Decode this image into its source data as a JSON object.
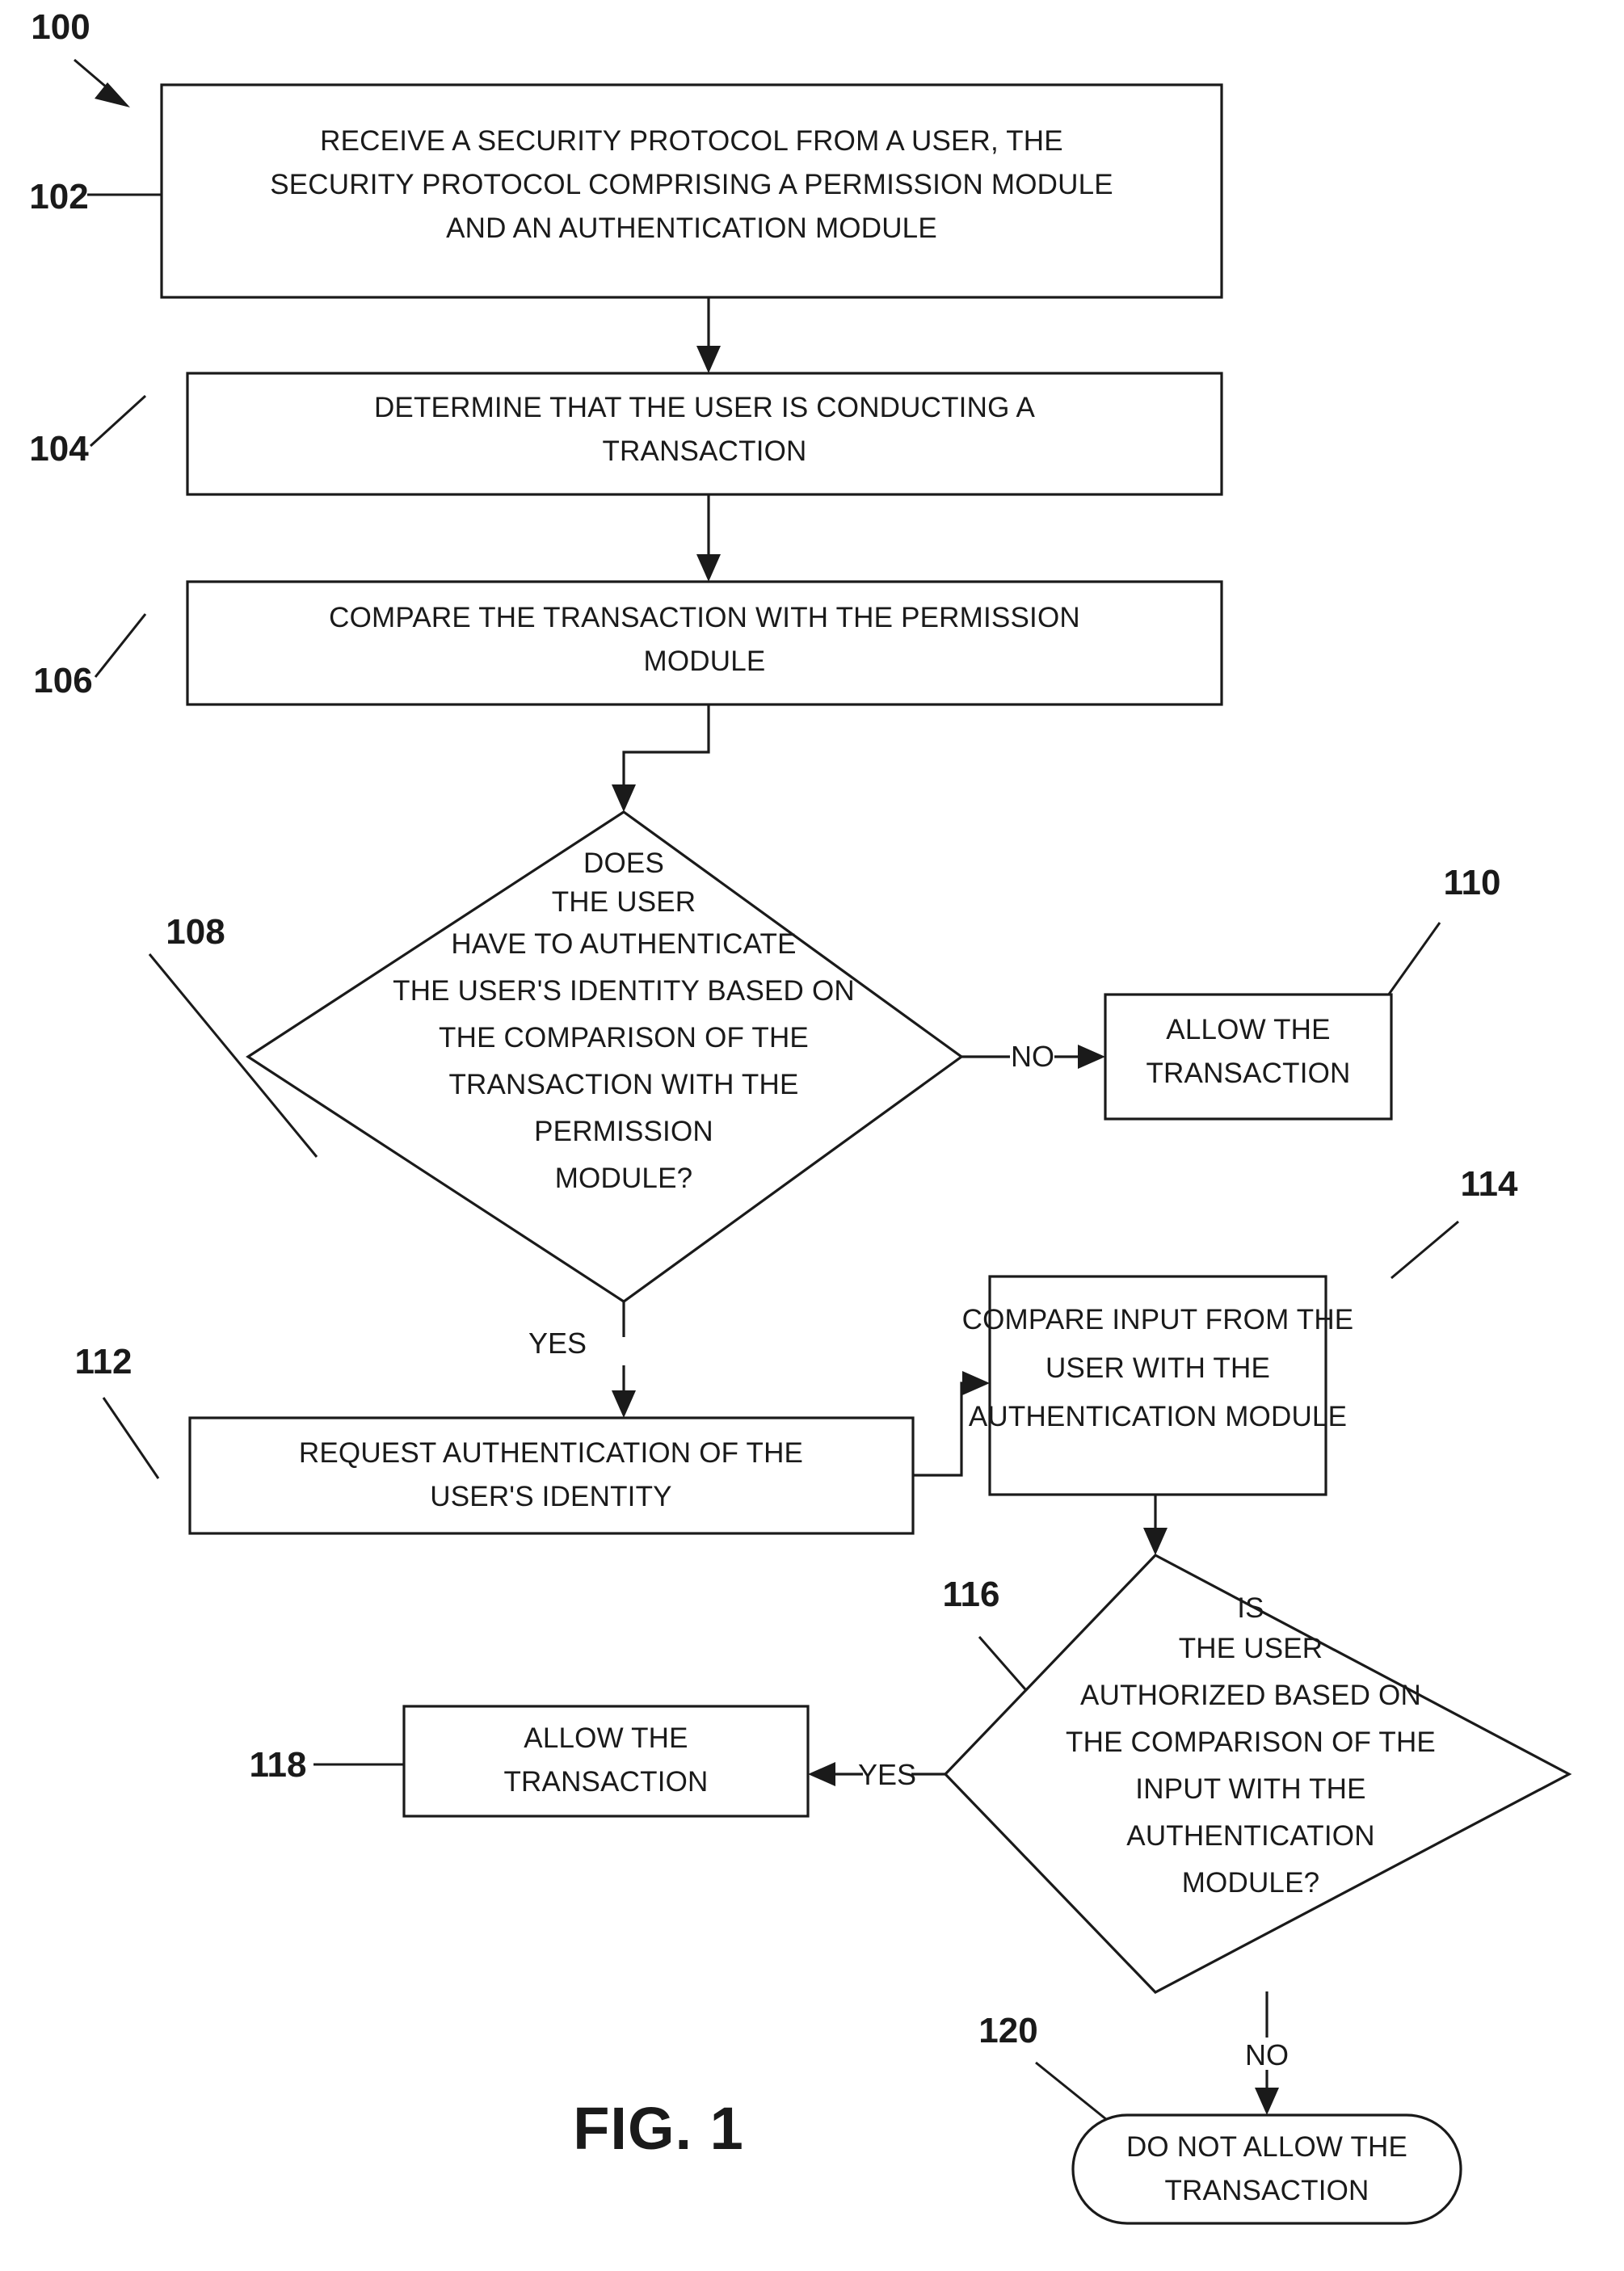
{
  "figure": {
    "caption": "FIG. 1",
    "diagram_label": "100"
  },
  "nodes": [
    {
      "id": "102",
      "ref": "102",
      "shape": "process",
      "lines": [
        "RECEIVE A SECURITY PROTOCOL FROM A USER, THE",
        "SECURITY PROTOCOL COMPRISING A PERMISSION MODULE",
        "AND AN AUTHENTICATION MODULE"
      ]
    },
    {
      "id": "104",
      "ref": "104",
      "shape": "process",
      "lines": [
        "DETERMINE THAT THE USER IS CONDUCTING A",
        "TRANSACTION"
      ]
    },
    {
      "id": "106",
      "ref": "106",
      "shape": "process",
      "lines": [
        "COMPARE THE TRANSACTION WITH THE PERMISSION",
        "MODULE"
      ]
    },
    {
      "id": "108",
      "ref": "108",
      "shape": "decision",
      "lines": [
        "DOES",
        "THE USER",
        "HAVE TO AUTHENTICATE",
        "THE USER'S IDENTITY BASED ON",
        "THE COMPARISON OF THE",
        "TRANSACTION WITH THE",
        "PERMISSION",
        "MODULE?"
      ]
    },
    {
      "id": "110",
      "ref": "110",
      "shape": "process",
      "lines": [
        "ALLOW THE",
        "TRANSACTION"
      ]
    },
    {
      "id": "112",
      "ref": "112",
      "shape": "process",
      "lines": [
        "REQUEST AUTHENTICATION OF THE",
        "USER'S IDENTITY"
      ]
    },
    {
      "id": "114",
      "ref": "114",
      "shape": "process",
      "lines": [
        "COMPARE INPUT FROM THE",
        "USER WITH THE",
        "AUTHENTICATION MODULE"
      ]
    },
    {
      "id": "116",
      "ref": "116",
      "shape": "decision",
      "lines": [
        "IS",
        "THE USER",
        "AUTHORIZED BASED ON",
        "THE COMPARISON OF THE",
        "INPUT WITH THE",
        "AUTHENTICATION",
        "MODULE?"
      ]
    },
    {
      "id": "118",
      "ref": "118",
      "shape": "process",
      "lines": [
        "ALLOW THE",
        "TRANSACTION"
      ]
    },
    {
      "id": "120",
      "ref": "120",
      "shape": "terminator",
      "lines": [
        "DO NOT ALLOW THE",
        "TRANSACTION"
      ]
    }
  ],
  "edges": [
    {
      "id": "e108-110",
      "label": "NO",
      "from": "108",
      "to": "110"
    },
    {
      "id": "e108-112",
      "label": "YES",
      "from": "108",
      "to": "112"
    },
    {
      "id": "e116-118",
      "label": "YES",
      "from": "116",
      "to": "118"
    },
    {
      "id": "e116-120",
      "label": "NO",
      "from": "116",
      "to": "120"
    }
  ],
  "colors": {
    "ink": "#1a1a1a",
    "paper": "#ffffff"
  }
}
